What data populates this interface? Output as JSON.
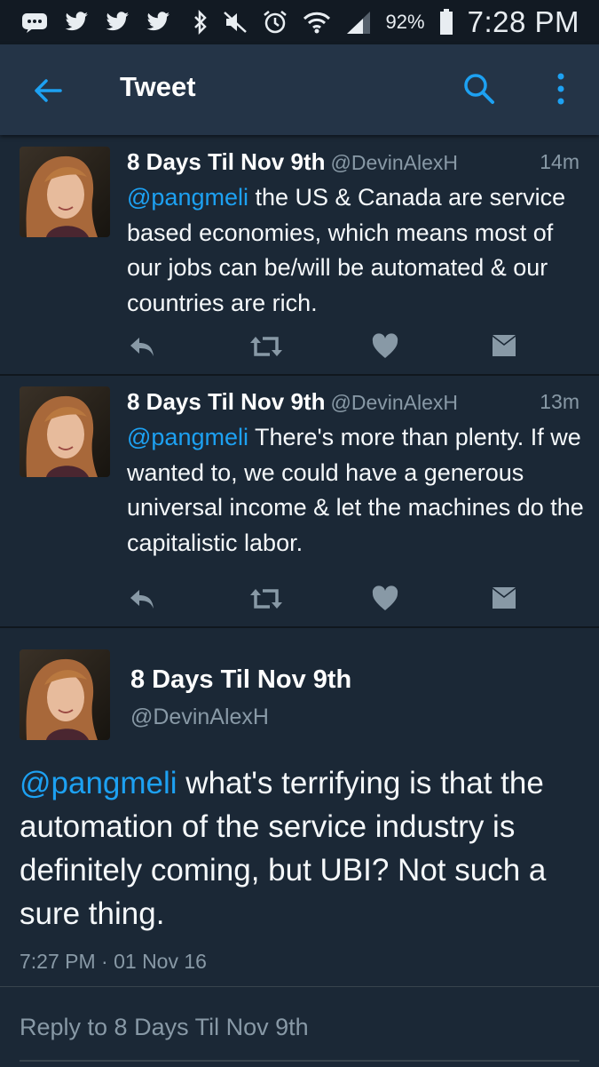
{
  "status_bar": {
    "left_icons": [
      "message-icon",
      "twitter-icon",
      "twitter-icon",
      "twitter-icon"
    ],
    "right_icons": [
      "bluetooth-icon",
      "mute-icon",
      "alarm-icon",
      "wifi-icon",
      "signal-icon",
      "battery-icon"
    ],
    "battery_percent": "92%",
    "time": "7:28 PM"
  },
  "app_bar": {
    "title": "Tweet",
    "back_icon": "back-arrow-icon",
    "search_icon": "search-icon",
    "more_icon": "more-vertical-icon"
  },
  "colors": {
    "background": "#1b2836",
    "app_bar": "#243447",
    "accent": "#1da1f2",
    "secondary_text": "#8899a6"
  },
  "tweets": [
    {
      "name": "8 Days Til Nov 9th",
      "handle": "@DevinAlexH",
      "age": "14m",
      "mention": "@pangmeli",
      "text": " the US & Canada are service based economies, which means most of our jobs can be/will be automated & our countries are rich.",
      "actions": [
        "reply-icon",
        "retweet-icon",
        "like-icon",
        "direct-message-icon"
      ]
    },
    {
      "name": "8 Days Til Nov 9th",
      "handle": "@DevinAlexH",
      "age": "13m",
      "mention": "@pangmeli",
      "text": " There's more than plenty. If we wanted to, we could have a generous universal income & let the machines do the capitalistic labor.",
      "actions": [
        "reply-icon",
        "retweet-icon",
        "like-icon",
        "direct-message-icon"
      ]
    }
  ],
  "main_tweet": {
    "name": "8 Days Til Nov 9th",
    "handle": "@DevinAlexH",
    "mention": "@pangmeli",
    "text": " what's terrifying is that the automation of the service industry is definitely coming, but UBI? Not such a sure thing.",
    "timestamp": "7:27 PM · 01 Nov 16"
  },
  "reply_box": {
    "placeholder": "Reply to 8 Days Til Nov 9th"
  }
}
